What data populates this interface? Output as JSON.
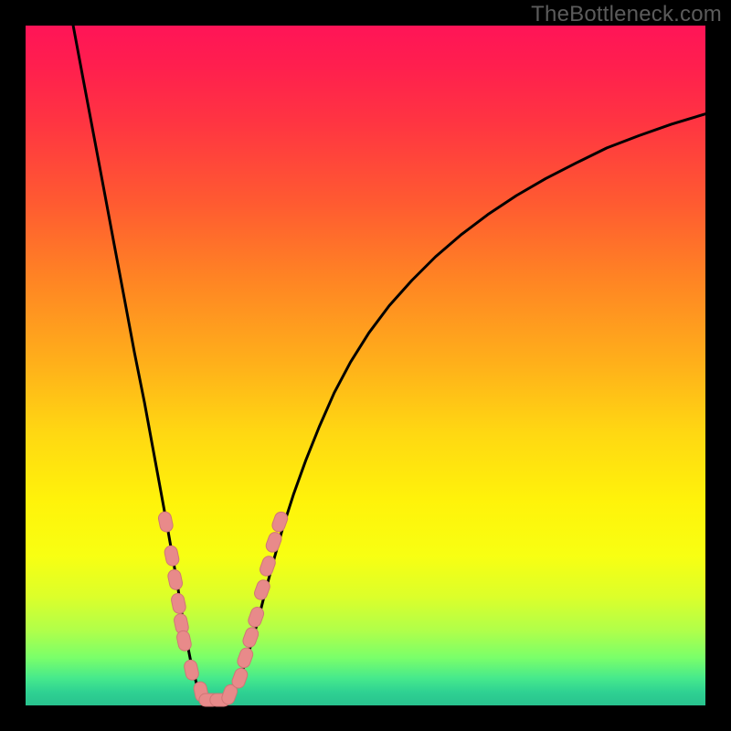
{
  "watermark": "TheBottleneck.com",
  "colors": {
    "frame": "#000000",
    "curve_stroke": "#000000",
    "marker_fill": "#e88a8a",
    "marker_stroke": "#d07676"
  },
  "chart_data": {
    "type": "line",
    "title": "",
    "xlabel": "",
    "ylabel": "",
    "xlim": [
      0,
      100
    ],
    "ylim": [
      0,
      100
    ],
    "curve_xy_percent": [
      [
        7.0,
        100.0
      ],
      [
        8.5,
        92.0
      ],
      [
        10.0,
        84.0
      ],
      [
        11.5,
        76.0
      ],
      [
        13.0,
        68.0
      ],
      [
        14.5,
        60.0
      ],
      [
        16.0,
        52.0
      ],
      [
        17.5,
        44.5
      ],
      [
        18.7,
        38.0
      ],
      [
        19.8,
        32.0
      ],
      [
        20.8,
        26.5
      ],
      [
        21.6,
        22.0
      ],
      [
        22.3,
        18.0
      ],
      [
        23.0,
        13.5
      ],
      [
        23.7,
        9.5
      ],
      [
        24.4,
        6.0
      ],
      [
        25.2,
        3.0
      ],
      [
        26.2,
        1.2
      ],
      [
        27.5,
        0.4
      ],
      [
        29.0,
        0.4
      ],
      [
        30.2,
        1.4
      ],
      [
        31.2,
        3.2
      ],
      [
        32.2,
        6.0
      ],
      [
        33.2,
        9.0
      ],
      [
        34.2,
        12.5
      ],
      [
        35.2,
        16.5
      ],
      [
        36.4,
        21.0
      ],
      [
        37.8,
        26.0
      ],
      [
        39.4,
        31.0
      ],
      [
        41.2,
        36.0
      ],
      [
        43.2,
        41.0
      ],
      [
        45.4,
        46.0
      ],
      [
        47.8,
        50.5
      ],
      [
        50.5,
        54.8
      ],
      [
        53.5,
        58.8
      ],
      [
        56.8,
        62.5
      ],
      [
        60.3,
        66.0
      ],
      [
        64.0,
        69.2
      ],
      [
        68.0,
        72.2
      ],
      [
        72.2,
        75.0
      ],
      [
        76.5,
        77.5
      ],
      [
        81.0,
        79.8
      ],
      [
        85.5,
        82.0
      ],
      [
        90.2,
        83.8
      ],
      [
        95.0,
        85.5
      ],
      [
        100.0,
        87.0
      ]
    ],
    "markers_xy_percent": [
      [
        20.6,
        27.0
      ],
      [
        21.5,
        22.0
      ],
      [
        22.0,
        18.5
      ],
      [
        22.5,
        15.0
      ],
      [
        22.9,
        12.0
      ],
      [
        23.3,
        9.5
      ],
      [
        24.4,
        5.2
      ],
      [
        25.8,
        2.0
      ],
      [
        27.0,
        0.8
      ],
      [
        28.6,
        0.8
      ],
      [
        30.0,
        1.6
      ],
      [
        31.5,
        4.0
      ],
      [
        32.3,
        7.0
      ],
      [
        33.1,
        10.0
      ],
      [
        33.9,
        13.0
      ],
      [
        34.8,
        17.0
      ],
      [
        35.6,
        20.5
      ],
      [
        36.5,
        24.0
      ],
      [
        37.4,
        27.0
      ]
    ],
    "note": "Values are percentages of the plot area; y is measured from the bottom (0) to the top (100). No axis ticks or labels are visible."
  }
}
